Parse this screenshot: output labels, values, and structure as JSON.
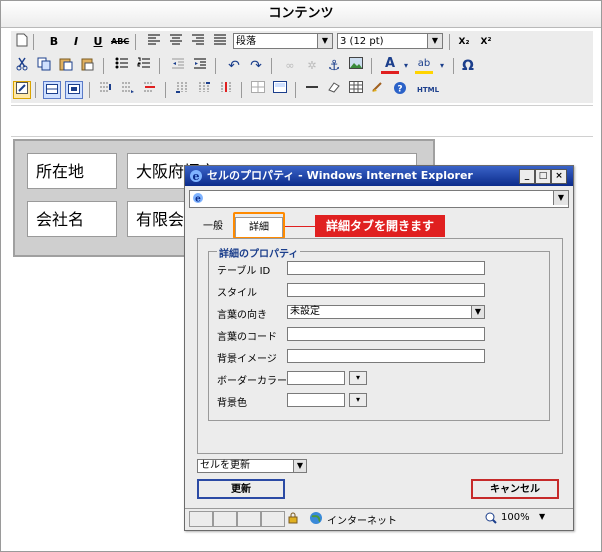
{
  "page_title": "コンテンツ",
  "toolbar": {
    "row1": [
      "new-doc-icon",
      "bold-icon",
      "italic-icon",
      "underline-icon",
      "strike-icon",
      "align-left-icon",
      "align-center-icon",
      "align-right-icon",
      "align-justify-icon",
      "subscript-icon",
      "superscript-icon"
    ],
    "format_select": "段落",
    "fontsize_select": "3 (12 pt)",
    "html_label": "HTML",
    "omega_label": "Ω",
    "sub_label": "X₂",
    "sup_label": "X²",
    "bold_label": "B",
    "italic_label": "I",
    "underline_label": "U",
    "abc_label": "ABC"
  },
  "table": {
    "row1_col1": "所在地",
    "row1_col2": "大阪府堺市",
    "row2_col1": "会社名",
    "row2_col2": "有限会社"
  },
  "dialog": {
    "title": "セルのプロパティ - Windows Internet Explorer",
    "tab_general": "一般",
    "tab_detail": "詳細",
    "callout": "詳細タブを開きます",
    "legend": "詳細のプロパティ",
    "fields": {
      "table_id_label": "テーブル ID",
      "style_label": "スタイル",
      "dir_label": "言葉の向き",
      "dir_value": "未設定",
      "lang_label": "言葉のコード",
      "bgimg_label": "背景イメージ",
      "border_color_label": "ボーダーカラー",
      "bgcolor_label": "背景色"
    },
    "update_select": "セルを更新",
    "update_button": "更新",
    "cancel_button": "キャンセル",
    "status_zone": "インターネット",
    "status_zoom": "100%"
  }
}
